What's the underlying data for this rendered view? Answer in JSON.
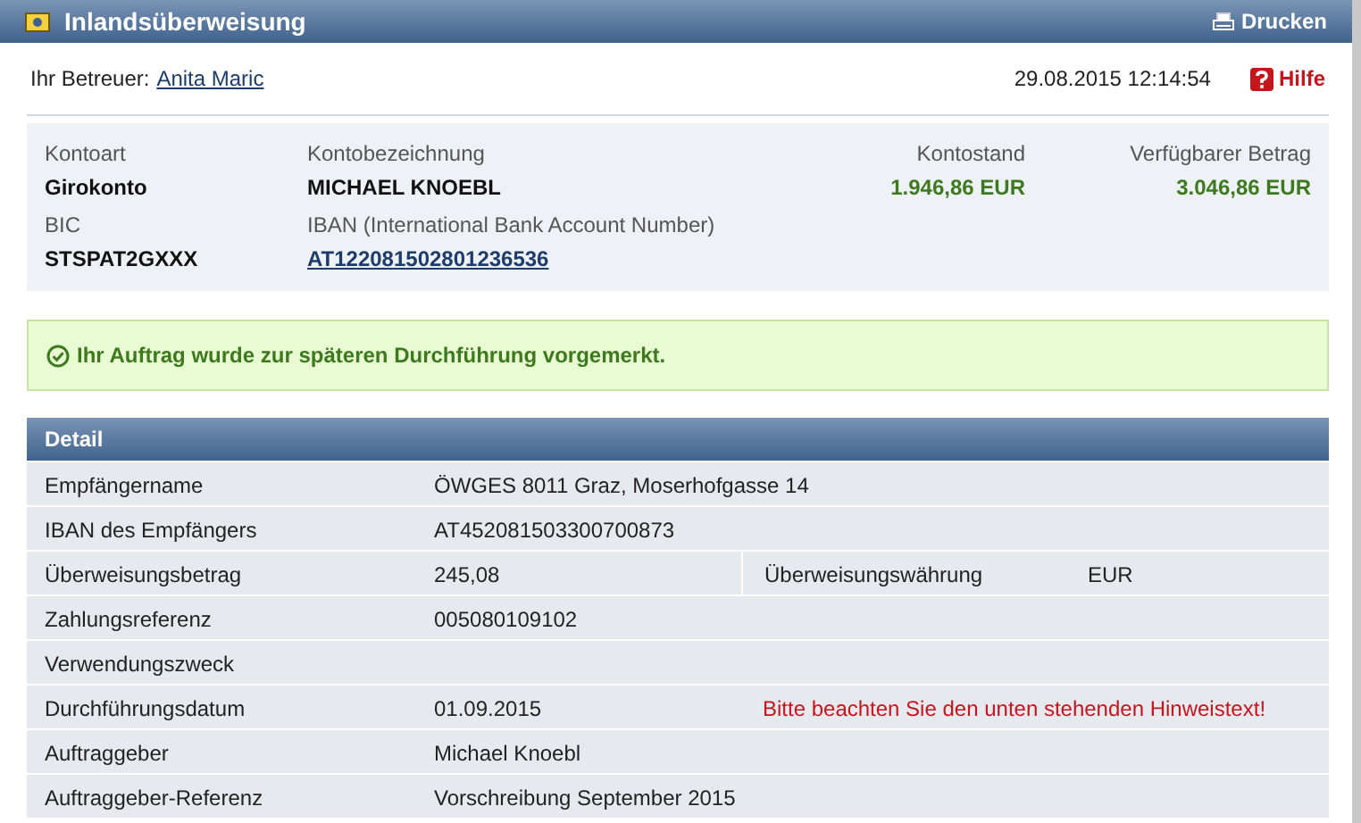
{
  "title": "Inlandsüberweisung",
  "print_button": "Drucken",
  "advisor": {
    "label": "Ihr Betreuer:",
    "name": "Anita Maric"
  },
  "timestamp": "29.08.2015 12:14:54",
  "help_button": "Hilfe",
  "account": {
    "type_label": "Kontoart",
    "type": "Girokonto",
    "name_label": "Kontobezeichnung",
    "name": "MICHAEL KNOEBL",
    "balance_label": "Kontostand",
    "balance": "1.946,86 EUR",
    "available_label": "Verfügbarer Betrag",
    "available": "3.046,86 EUR",
    "bic_label": "BIC",
    "bic": "STSPAT2GXXX",
    "iban_label": "IBAN (International Bank Account Number)",
    "iban": "AT122081502801236536"
  },
  "message": "Ihr Auftrag wurde zur späteren Durchführung vorgemerkt.",
  "detail": {
    "title": "Detail",
    "rows": [
      {
        "kind": "plain",
        "label": "Empfängername",
        "value": "ÖWGES 8011 Graz, Moserhofgasse 14"
      },
      {
        "kind": "plain",
        "label": "IBAN des Empfängers",
        "value": "AT452081503300700873"
      },
      {
        "kind": "split",
        "label": "Überweisungsbetrag",
        "value": "245,08",
        "label2": "Überweisungswährung",
        "value2": "EUR"
      },
      {
        "kind": "plain",
        "label": "Zahlungsreferenz",
        "value": "005080109102"
      },
      {
        "kind": "plain",
        "label": "Verwendungszweck"
      },
      {
        "kind": "note",
        "label": "Durchführungsdatum",
        "value": "01.09.2015",
        "note": "Bitte beachten Sie den unten stehenden Hinweistext!"
      },
      {
        "kind": "plain",
        "label": "Auftraggeber",
        "value": "Michael Knoebl"
      },
      {
        "kind": "plain",
        "label": "Auftraggeber-Referenz",
        "value": "Vorschreibung September 2015"
      }
    ]
  }
}
